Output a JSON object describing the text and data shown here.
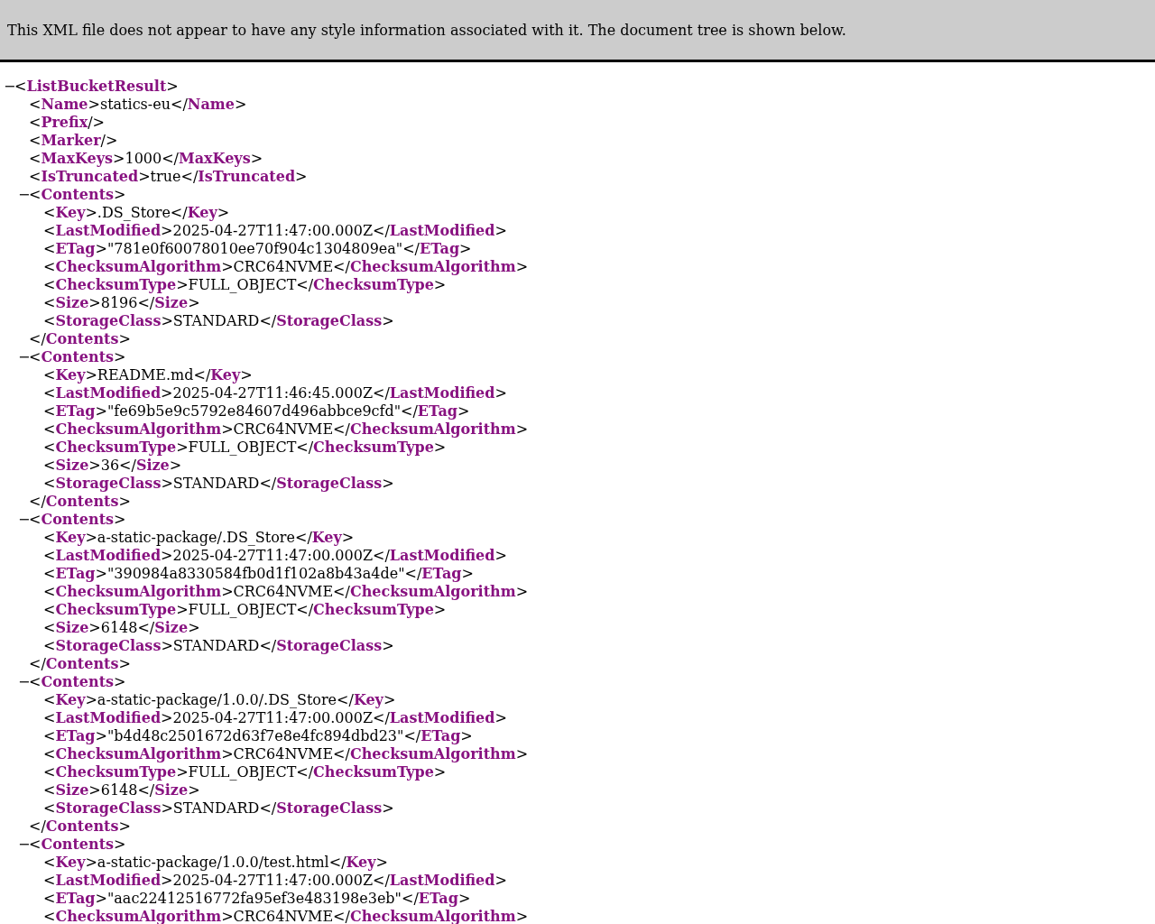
{
  "banner": {
    "message": "This XML file does not appear to have any style information associated with it. The document tree is shown below."
  },
  "syntax": {
    "open": "<",
    "close": ">",
    "end_open": "</",
    "self_close": "/>"
  },
  "tree": {
    "kind": "parent",
    "tag": "ListBucketResult",
    "toggle": "−",
    "expanded": true,
    "children": [
      {
        "kind": "leaf",
        "tag": "Name",
        "text": "statics-eu",
        "end_tag": "Name"
      },
      {
        "kind": "empty",
        "tag": "Prefix"
      },
      {
        "kind": "empty",
        "tag": "Marker"
      },
      {
        "kind": "leaf",
        "tag": "MaxKeys",
        "text": "1000",
        "end_tag": "MaxKeys"
      },
      {
        "kind": "leaf",
        "tag": "IsTruncated",
        "text": "true",
        "end_tag": "IsTruncated"
      },
      {
        "kind": "parent",
        "tag": "Contents",
        "toggle": "−",
        "expanded": true,
        "end_tag": "Contents",
        "children": [
          {
            "kind": "leaf",
            "tag": "Key",
            "text": ".DS_Store",
            "end_tag": "Key"
          },
          {
            "kind": "leaf",
            "tag": "LastModified",
            "text": "2025-04-27T11:47:00.000Z",
            "end_tag": "LastModified"
          },
          {
            "kind": "leaf",
            "tag": "ETag",
            "text": "\"781e0f60078010ee70f904c1304809ea\"",
            "end_tag": "ETag"
          },
          {
            "kind": "leaf",
            "tag": "ChecksumAlgorithm",
            "text": "CRC64NVME",
            "end_tag": "ChecksumAlgorithm"
          },
          {
            "kind": "leaf",
            "tag": "ChecksumType",
            "text": "FULL_OBJECT",
            "end_tag": "ChecksumType"
          },
          {
            "kind": "leaf",
            "tag": "Size",
            "text": "8196",
            "end_tag": "Size"
          },
          {
            "kind": "leaf",
            "tag": "StorageClass",
            "text": "STANDARD",
            "end_tag": "StorageClass"
          }
        ]
      },
      {
        "kind": "parent",
        "tag": "Contents",
        "toggle": "−",
        "expanded": true,
        "end_tag": "Contents",
        "children": [
          {
            "kind": "leaf",
            "tag": "Key",
            "text": "README.md",
            "end_tag": "Key"
          },
          {
            "kind": "leaf",
            "tag": "LastModified",
            "text": "2025-04-27T11:46:45.000Z",
            "end_tag": "LastModified"
          },
          {
            "kind": "leaf",
            "tag": "ETag",
            "text": "\"fe69b5e9c5792e84607d496abbce9cfd\"",
            "end_tag": "ETag"
          },
          {
            "kind": "leaf",
            "tag": "ChecksumAlgorithm",
            "text": "CRC64NVME",
            "end_tag": "ChecksumAlgorithm"
          },
          {
            "kind": "leaf",
            "tag": "ChecksumType",
            "text": "FULL_OBJECT",
            "end_tag": "ChecksumType"
          },
          {
            "kind": "leaf",
            "tag": "Size",
            "text": "36",
            "end_tag": "Size"
          },
          {
            "kind": "leaf",
            "tag": "StorageClass",
            "text": "STANDARD",
            "end_tag": "StorageClass"
          }
        ]
      },
      {
        "kind": "parent",
        "tag": "Contents",
        "toggle": "−",
        "expanded": true,
        "end_tag": "Contents",
        "children": [
          {
            "kind": "leaf",
            "tag": "Key",
            "text": "a-static-package/.DS_Store",
            "end_tag": "Key"
          },
          {
            "kind": "leaf",
            "tag": "LastModified",
            "text": "2025-04-27T11:47:00.000Z",
            "end_tag": "LastModified"
          },
          {
            "kind": "leaf",
            "tag": "ETag",
            "text": "\"390984a8330584fb0d1f102a8b43a4de\"",
            "end_tag": "ETag"
          },
          {
            "kind": "leaf",
            "tag": "ChecksumAlgorithm",
            "text": "CRC64NVME",
            "end_tag": "ChecksumAlgorithm"
          },
          {
            "kind": "leaf",
            "tag": "ChecksumType",
            "text": "FULL_OBJECT",
            "end_tag": "ChecksumType"
          },
          {
            "kind": "leaf",
            "tag": "Size",
            "text": "6148",
            "end_tag": "Size"
          },
          {
            "kind": "leaf",
            "tag": "StorageClass",
            "text": "STANDARD",
            "end_tag": "StorageClass"
          }
        ]
      },
      {
        "kind": "parent",
        "tag": "Contents",
        "toggle": "−",
        "expanded": true,
        "end_tag": "Contents",
        "children": [
          {
            "kind": "leaf",
            "tag": "Key",
            "text": "a-static-package/1.0.0/.DS_Store",
            "end_tag": "Key"
          },
          {
            "kind": "leaf",
            "tag": "LastModified",
            "text": "2025-04-27T11:47:00.000Z",
            "end_tag": "LastModified"
          },
          {
            "kind": "leaf",
            "tag": "ETag",
            "text": "\"b4d48c2501672d63f7e8e4fc894dbd23\"",
            "end_tag": "ETag"
          },
          {
            "kind": "leaf",
            "tag": "ChecksumAlgorithm",
            "text": "CRC64NVME",
            "end_tag": "ChecksumAlgorithm"
          },
          {
            "kind": "leaf",
            "tag": "ChecksumType",
            "text": "FULL_OBJECT",
            "end_tag": "ChecksumType"
          },
          {
            "kind": "leaf",
            "tag": "Size",
            "text": "6148",
            "end_tag": "Size"
          },
          {
            "kind": "leaf",
            "tag": "StorageClass",
            "text": "STANDARD",
            "end_tag": "StorageClass"
          }
        ]
      },
      {
        "kind": "parent",
        "tag": "Contents",
        "toggle": "−",
        "expanded": true,
        "children": [
          {
            "kind": "leaf",
            "tag": "Key",
            "text": "a-static-package/1.0.0/test.html",
            "end_tag": "Key"
          },
          {
            "kind": "leaf",
            "tag": "LastModified",
            "text": "2025-04-27T11:47:00.000Z",
            "end_tag": "LastModified"
          },
          {
            "kind": "leaf",
            "tag": "ETag",
            "text": "\"aac22412516772fa95ef3e483198e3eb\"",
            "end_tag": "ETag"
          },
          {
            "kind": "leaf",
            "tag": "ChecksumAlgorithm",
            "text": "CRC64NVME",
            "end_tag": "ChecksumAlgorithm"
          }
        ]
      }
    ]
  }
}
